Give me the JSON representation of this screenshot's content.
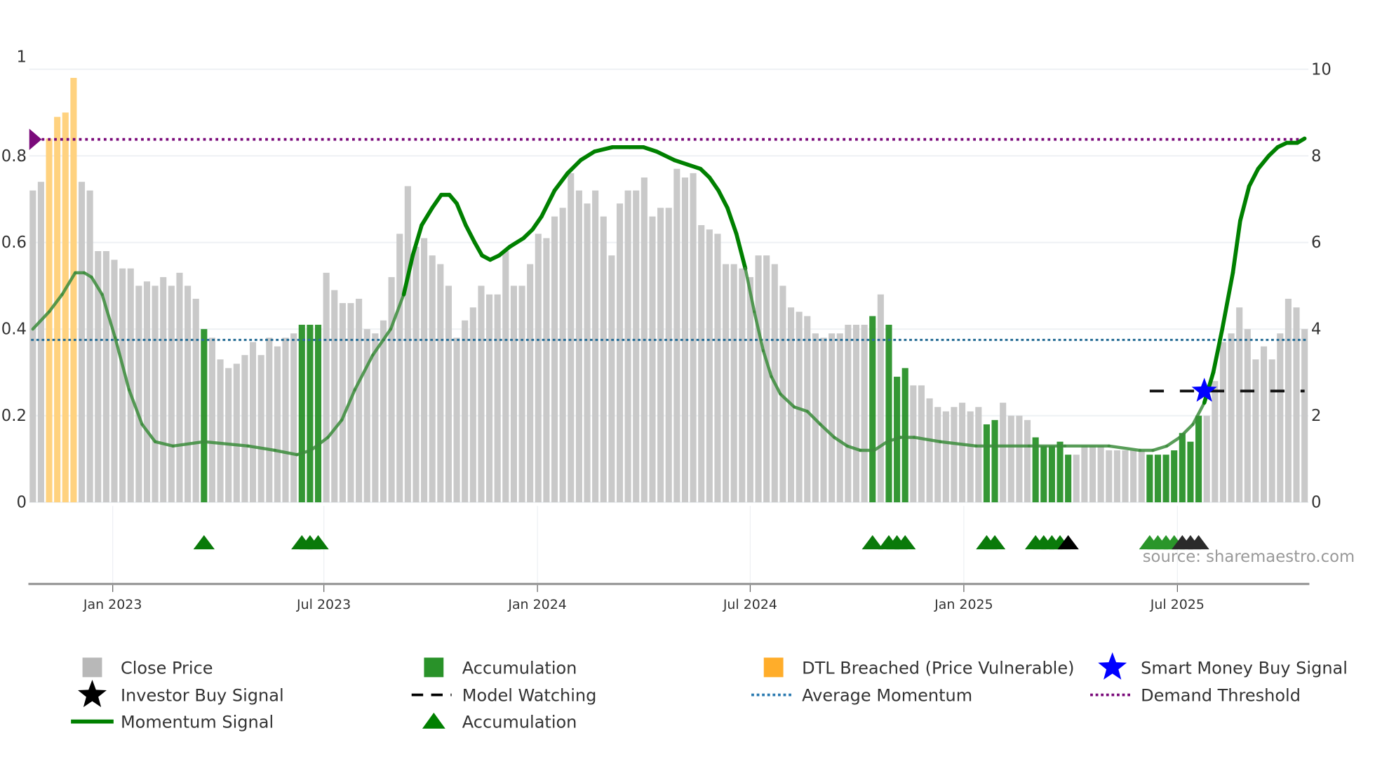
{
  "chart_data": {
    "type": "bar",
    "title": "",
    "xlabel": "",
    "ylabel": "",
    "ylim_left": [
      0,
      1
    ],
    "ylim_right": [
      0,
      10
    ],
    "left_ticks": [
      "0",
      "0.2",
      "0.4",
      "0.6",
      "0.8",
      "1"
    ],
    "right_ticks": [
      "0",
      "2",
      "4",
      "6",
      "8",
      "10"
    ],
    "x_ticks": [
      {
        "label": "Jan 2023",
        "week": 9.8
      },
      {
        "label": "Jul 2023",
        "week": 35.7
      },
      {
        "label": "Jan 2024",
        "week": 61.9
      },
      {
        "label": "Jul 2024",
        "week": 88.0
      },
      {
        "label": "Jan 2025",
        "week": 114.2
      },
      {
        "label": "Jul 2025",
        "week": 140.4
      }
    ],
    "close_price_bars": [
      0.72,
      0.74,
      0.84,
      0.89,
      0.9,
      0.98,
      0.74,
      0.72,
      0.58,
      0.58,
      0.56,
      0.54,
      0.54,
      0.5,
      0.51,
      0.5,
      0.52,
      0.5,
      0.53,
      0.5,
      0.47,
      0.4,
      0.38,
      0.33,
      0.31,
      0.32,
      0.34,
      0.37,
      0.34,
      0.38,
      0.36,
      0.38,
      0.39,
      0.41,
      0.41,
      0.41,
      0.53,
      0.49,
      0.46,
      0.46,
      0.47,
      0.4,
      0.39,
      0.42,
      0.52,
      0.62,
      0.73,
      0.59,
      0.61,
      0.57,
      0.55,
      0.5,
      0.38,
      0.42,
      0.45,
      0.5,
      0.48,
      0.48,
      0.58,
      0.5,
      0.5,
      0.55,
      0.62,
      0.61,
      0.66,
      0.68,
      0.76,
      0.72,
      0.69,
      0.72,
      0.66,
      0.57,
      0.69,
      0.72,
      0.72,
      0.75,
      0.66,
      0.68,
      0.68,
      0.77,
      0.75,
      0.76,
      0.64,
      0.63,
      0.62,
      0.55,
      0.55,
      0.54,
      0.52,
      0.57,
      0.57,
      0.55,
      0.5,
      0.45,
      0.44,
      0.43,
      0.39,
      0.38,
      0.39,
      0.39,
      0.41,
      0.41,
      0.41,
      0.43,
      0.48,
      0.41,
      0.29,
      0.31,
      0.27,
      0.27,
      0.24,
      0.22,
      0.21,
      0.22,
      0.23,
      0.21,
      0.22,
      0.18,
      0.19,
      0.23,
      0.2,
      0.2,
      0.19,
      0.15,
      0.13,
      0.13,
      0.14,
      0.11,
      0.11,
      0.13,
      0.13,
      0.13,
      0.12,
      0.12,
      0.12,
      0.12,
      0.12,
      0.11,
      0.11,
      0.11,
      0.12,
      0.16,
      0.14,
      0.2,
      0.2,
      0.28,
      0.37,
      0.39,
      0.45,
      0.4,
      0.33,
      0.36,
      0.33,
      0.39,
      0.47,
      0.45,
      0.4
    ],
    "accumulation_bar_indices": [
      21,
      33,
      34,
      35,
      103,
      105,
      106,
      107,
      117,
      118,
      123,
      124,
      125,
      126,
      127,
      137,
      138,
      139,
      140,
      141,
      142,
      143
    ],
    "dtl_breached_bar_indices": [
      2,
      3,
      4,
      5
    ],
    "momentum_signal": [
      [
        0,
        0.4
      ],
      [
        2,
        0.44
      ],
      [
        3.6,
        0.48
      ],
      [
        5.2,
        0.53
      ],
      [
        6.3,
        0.53
      ],
      [
        7.2,
        0.52
      ],
      [
        8.5,
        0.48
      ],
      [
        10.1,
        0.38
      ],
      [
        11.8,
        0.26
      ],
      [
        13.4,
        0.18
      ],
      [
        15,
        0.14
      ],
      [
        17.2,
        0.13
      ],
      [
        21,
        0.14
      ],
      [
        26.4,
        0.13
      ],
      [
        29.7,
        0.12
      ],
      [
        32.4,
        0.11
      ],
      [
        34.1,
        0.12
      ],
      [
        36.2,
        0.15
      ],
      [
        37.9,
        0.19
      ],
      [
        39.5,
        0.26
      ],
      [
        41.7,
        0.34
      ],
      [
        43.9,
        0.4
      ],
      [
        45.5,
        0.48
      ],
      [
        46.6,
        0.57
      ],
      [
        47.7,
        0.64
      ],
      [
        49,
        0.68
      ],
      [
        50.1,
        0.71
      ],
      [
        51.1,
        0.71
      ],
      [
        52,
        0.69
      ],
      [
        53.1,
        0.64
      ],
      [
        54.2,
        0.6
      ],
      [
        55.1,
        0.57
      ],
      [
        56.1,
        0.56
      ],
      [
        57.2,
        0.57
      ],
      [
        58.5,
        0.59
      ],
      [
        60.2,
        0.61
      ],
      [
        61.3,
        0.63
      ],
      [
        62.4,
        0.66
      ],
      [
        64,
        0.72
      ],
      [
        65.6,
        0.76
      ],
      [
        67.2,
        0.79
      ],
      [
        68.9,
        0.81
      ],
      [
        71.1,
        0.82
      ],
      [
        73.2,
        0.82
      ],
      [
        74.9,
        0.82
      ],
      [
        76.5,
        0.81
      ],
      [
        78.7,
        0.79
      ],
      [
        80.3,
        0.78
      ],
      [
        81.9,
        0.77
      ],
      [
        83,
        0.75
      ],
      [
        84.1,
        0.72
      ],
      [
        85.2,
        0.68
      ],
      [
        86.3,
        0.62
      ],
      [
        87.4,
        0.54
      ],
      [
        88.5,
        0.44
      ],
      [
        89.6,
        0.35
      ],
      [
        90.6,
        0.29
      ],
      [
        91.7,
        0.25
      ],
      [
        93.4,
        0.22
      ],
      [
        95,
        0.21
      ],
      [
        96.6,
        0.18
      ],
      [
        98.3,
        0.15
      ],
      [
        99.9,
        0.13
      ],
      [
        101.5,
        0.12
      ],
      [
        103.2,
        0.12
      ],
      [
        104.8,
        0.14
      ],
      [
        106.4,
        0.15
      ],
      [
        108.1,
        0.15
      ],
      [
        111.3,
        0.14
      ],
      [
        115.7,
        0.13
      ],
      [
        122.2,
        0.13
      ],
      [
        126.6,
        0.13
      ],
      [
        132,
        0.13
      ],
      [
        135.8,
        0.12
      ],
      [
        137.4,
        0.12
      ],
      [
        139.1,
        0.13
      ],
      [
        140.7,
        0.15
      ],
      [
        142.3,
        0.18
      ],
      [
        143.7,
        0.23
      ],
      [
        144.8,
        0.3
      ],
      [
        145.9,
        0.4
      ],
      [
        147.2,
        0.53
      ],
      [
        148.1,
        0.65
      ],
      [
        149.2,
        0.73
      ],
      [
        150.3,
        0.77
      ],
      [
        151.6,
        0.8
      ],
      [
        152.7,
        0.82
      ],
      [
        153.8,
        0.83
      ],
      [
        155.1,
        0.83
      ],
      [
        156,
        0.84
      ]
    ],
    "average_momentum": 0.375,
    "demand_threshold": 0.838,
    "model_watching": {
      "from_week": 137,
      "to_week": 156,
      "value": 0.257
    },
    "smart_money_buy_signal": {
      "week": 143.7,
      "value": 0.257
    },
    "accumulation_markers": [
      21,
      33,
      34,
      35,
      103,
      105,
      106,
      107,
      117,
      118,
      123,
      124,
      125,
      126,
      137,
      138,
      139,
      140
    ],
    "investor_buy_markers": [
      127,
      141,
      142,
      143
    ],
    "source": "source: sharemaestro.com",
    "legend": [
      {
        "label": "Close Price",
        "color": "#b8b8b8",
        "shape": "square"
      },
      {
        "label": "Accumulation",
        "color": "#1e8c1e",
        "shape": "square"
      },
      {
        "label": "DTL Breached (Price Vulnerable)",
        "color": "#ffa91f",
        "shape": "square"
      },
      {
        "label": "Smart Money Buy Signal",
        "color": "#0000ff",
        "shape": "star"
      },
      {
        "label": "Investor Buy Signal",
        "color": "#000000",
        "shape": "star"
      },
      {
        "label": "Model Watching",
        "color": "#000000",
        "shape": "dash"
      },
      {
        "label": "Average Momentum",
        "color": "#2a7ab0",
        "shape": "dot"
      },
      {
        "label": "Demand Threshold",
        "color": "#7a0a7a",
        "shape": "dot"
      },
      {
        "label": "Momentum Signal",
        "color": "#008000",
        "shape": "line"
      },
      {
        "label": "Accumulation",
        "color": "#008000",
        "shape": "triangle"
      }
    ]
  }
}
